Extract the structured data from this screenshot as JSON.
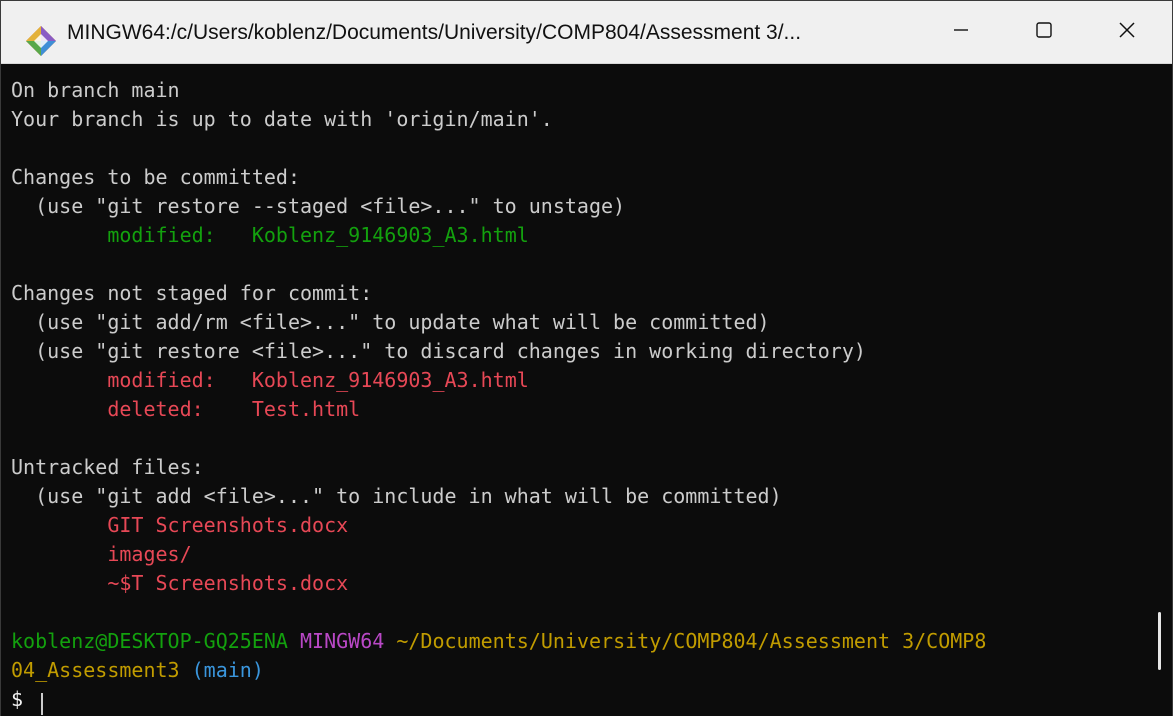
{
  "window": {
    "title": "MINGW64:/c/Users/koblenz/Documents/University/COMP804/Assessment 3/...",
    "minimize_glyph": "—",
    "maximize_glyph": "☐",
    "close_glyph": "✕"
  },
  "terminal": {
    "status_header": {
      "branch_line": "On branch main",
      "upstream_line": "Your branch is up to date with 'origin/main'."
    },
    "staged": {
      "heading": "Changes to be committed:",
      "hint": "  (use \"git restore --staged <file>...\" to unstage)",
      "entries": [
        {
          "status": "modified:",
          "file": "Koblenz_9146903_A3.html"
        }
      ]
    },
    "unstaged": {
      "heading": "Changes not staged for commit:",
      "hints": [
        "  (use \"git add/rm <file>...\" to update what will be committed)",
        "  (use \"git restore <file>...\" to discard changes in working directory)"
      ],
      "entries": [
        {
          "status": "modified:",
          "file": "Koblenz_9146903_A3.html"
        },
        {
          "status": "deleted:",
          "file": "Test.html"
        }
      ]
    },
    "untracked": {
      "heading": "Untracked files:",
      "hint": "  (use \"git add <file>...\" to include in what will be committed)",
      "files": [
        "GIT Screenshots.docx",
        "images/",
        "~$T Screenshots.docx"
      ]
    },
    "prompt": {
      "user_host": "koblenz@DESKTOP-GQ25ENA",
      "system": "MINGW64",
      "path_line1": "~/Documents/University/COMP804/Assessment 3/COMP8",
      "path_line2": "04_Assessment3",
      "branch": "(main)",
      "symbol": "$"
    }
  },
  "colors": {
    "staged": "#13a10e",
    "unstaged": "#e74856",
    "system": "#b948c6",
    "path": "#c19c00",
    "branch": "#3a96dd"
  },
  "icons": {
    "app": "git-diamond-icon"
  }
}
